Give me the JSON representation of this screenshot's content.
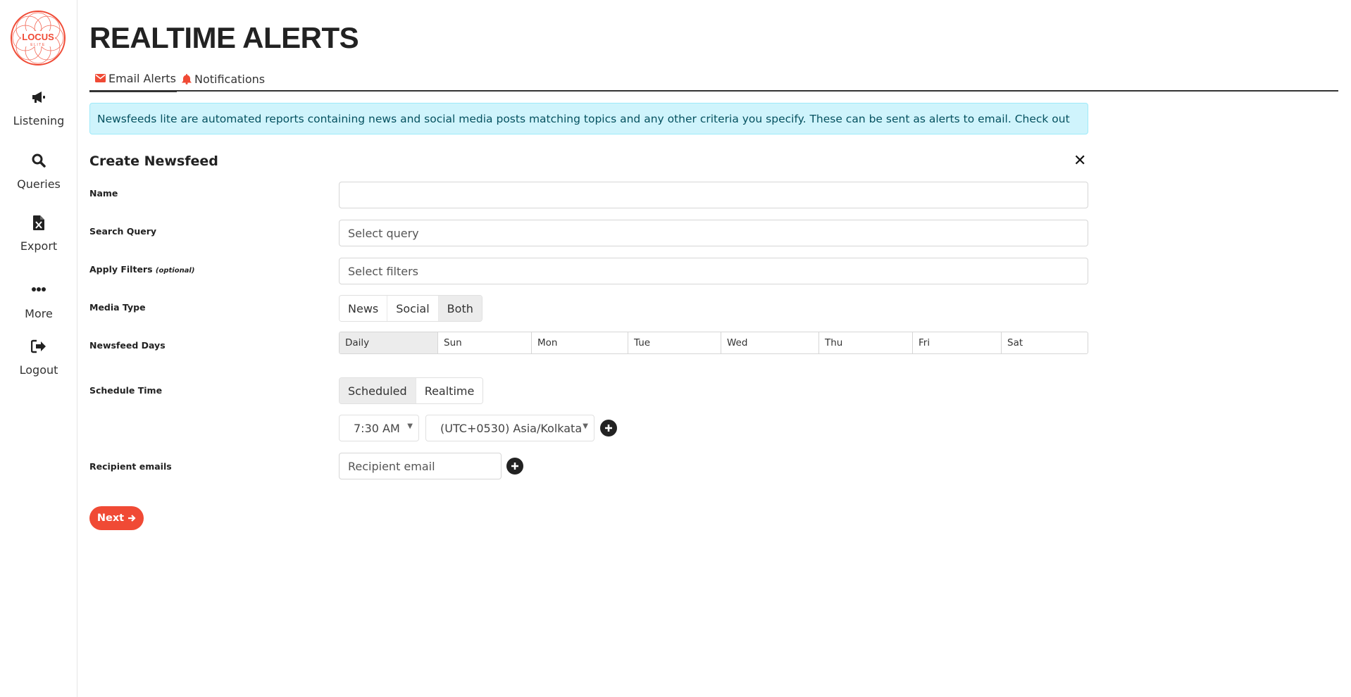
{
  "app": {
    "logo_text": "LOCUS",
    "logo_subtext": "ELITE",
    "brand_color": "#f04a35"
  },
  "sidebar": {
    "items": [
      {
        "label": "Listening",
        "icon": "megaphone-icon"
      },
      {
        "label": "Queries",
        "icon": "search-icon"
      },
      {
        "label": "Export",
        "icon": "excel-file-icon"
      },
      {
        "label": "More",
        "icon": "ellipsis-icon"
      },
      {
        "label": "Logout",
        "icon": "sign-out-icon"
      }
    ]
  },
  "page": {
    "title": "REALTIME ALERTS",
    "tabs": [
      {
        "label": "Email Alerts",
        "icon": "envelope-icon",
        "active": true
      },
      {
        "label": "Notifications",
        "icon": "bell-icon",
        "active": false
      }
    ],
    "info_text": "Newsfeeds lite are automated reports containing news and social media posts matching topics and any other criteria you specify. These can be sent as alerts to email. Check out"
  },
  "form": {
    "title": "Create Newsfeed",
    "close_icon": "close-icon",
    "name": {
      "label": "Name",
      "value": "",
      "placeholder": ""
    },
    "search_query": {
      "label": "Search Query",
      "placeholder": "Select query"
    },
    "filters": {
      "label": "Apply Filters",
      "optional": "(optional)",
      "placeholder": "Select filters"
    },
    "media_type": {
      "label": "Media Type",
      "options": [
        "News",
        "Social",
        "Both"
      ],
      "selected": "Both"
    },
    "newsfeed_days": {
      "label": "Newsfeed Days",
      "options": [
        "Daily",
        "Sun",
        "Mon",
        "Tue",
        "Wed",
        "Thu",
        "Fri",
        "Sat"
      ],
      "selected": "Daily"
    },
    "schedule": {
      "label": "Schedule Time",
      "options": [
        "Scheduled",
        "Realtime"
      ],
      "selected": "Scheduled",
      "time": "7:30 AM",
      "timezone": "(UTC+0530) Asia/Kolkata"
    },
    "recipients": {
      "label": "Recipient emails",
      "placeholder": "Recipient email"
    },
    "next_label": "Next"
  }
}
